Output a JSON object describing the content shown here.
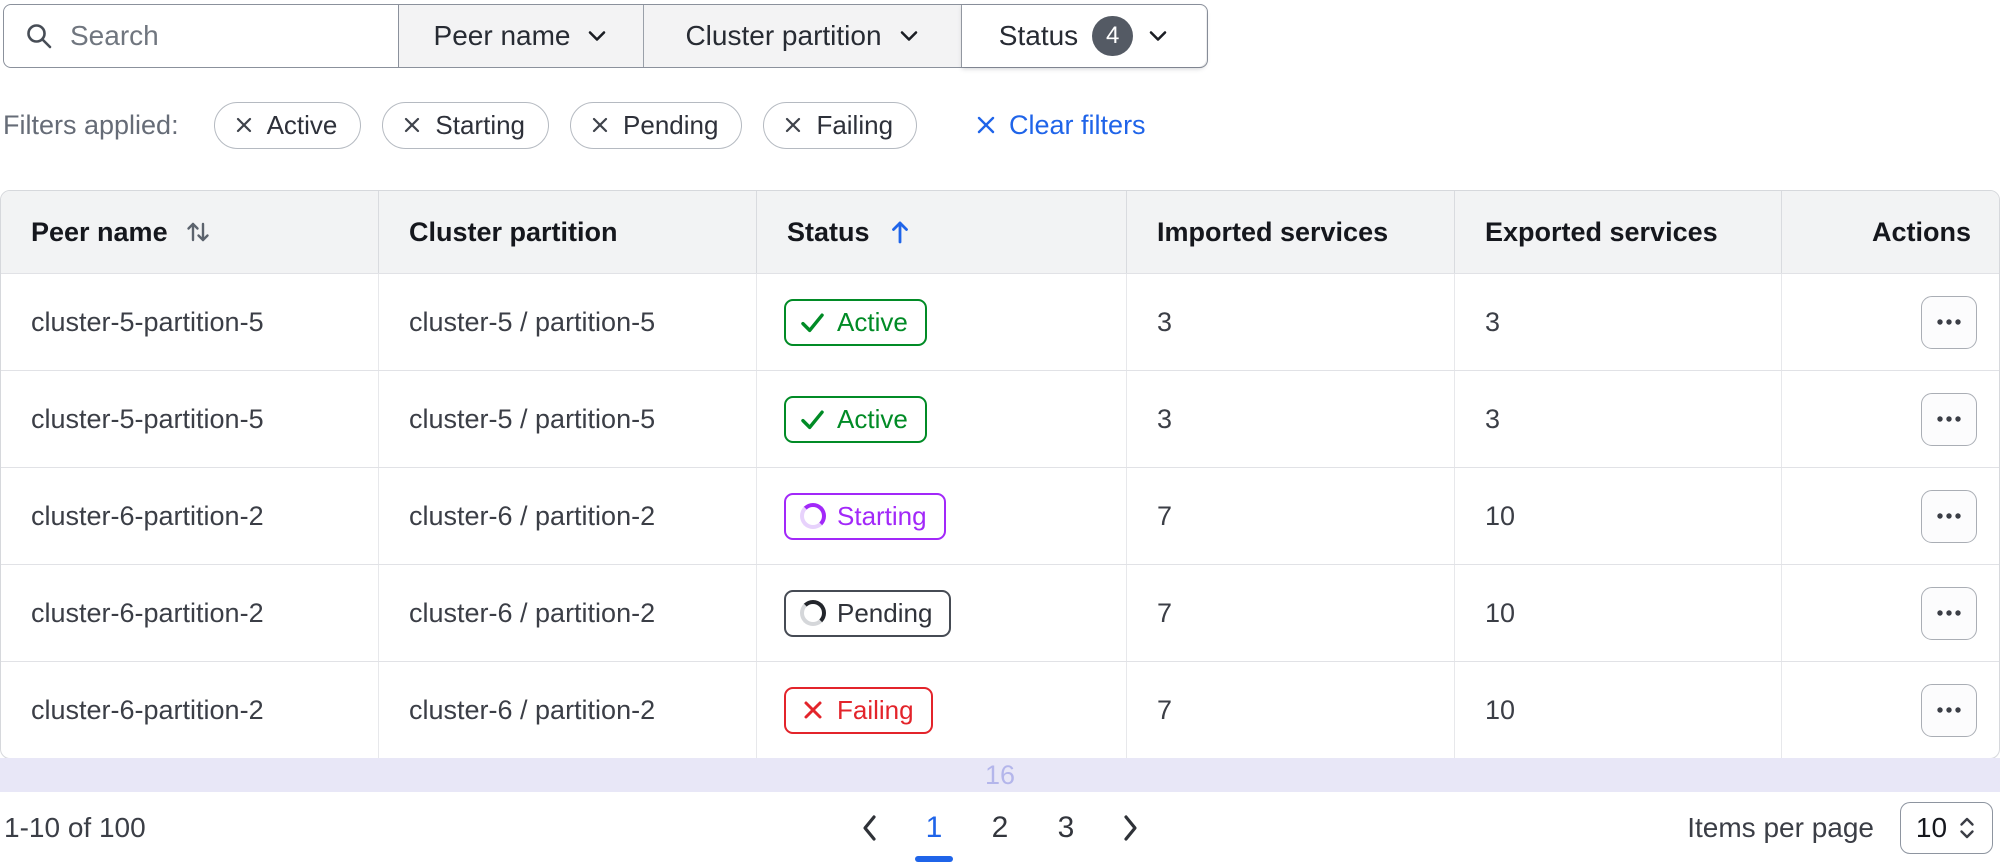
{
  "filters_bar": {
    "search_placeholder": "Search",
    "peer_dropdown": {
      "label": "Peer name"
    },
    "partition_dropdown": {
      "label": "Cluster partition"
    },
    "status_dropdown": {
      "label": "Status",
      "badge": "4"
    }
  },
  "applied": {
    "label": "Filters applied:",
    "pills": [
      "Active",
      "Starting",
      "Pending",
      "Failing"
    ],
    "clear_label": "Clear filters"
  },
  "table": {
    "columns": [
      "Peer name",
      "Cluster partition",
      "Status",
      "Imported services",
      "Exported services",
      "Actions"
    ],
    "sorted_column": "Status",
    "sort_direction": "ascending",
    "rows": [
      {
        "peer": "cluster-5-partition-5",
        "partition": "cluster-5 / partition-5",
        "status": "Active",
        "status_kind": "active",
        "imported": "3",
        "exported": "3"
      },
      {
        "peer": "cluster-5-partition-5",
        "partition": "cluster-5 / partition-5",
        "status": "Active",
        "status_kind": "active",
        "imported": "3",
        "exported": "3"
      },
      {
        "peer": "cluster-6-partition-2",
        "partition": "cluster-6 / partition-2",
        "status": "Starting",
        "status_kind": "starting",
        "imported": "7",
        "exported": "10"
      },
      {
        "peer": "cluster-6-partition-2",
        "partition": "cluster-6 / partition-2",
        "status": "Pending",
        "status_kind": "pending",
        "imported": "7",
        "exported": "10"
      },
      {
        "peer": "cluster-6-partition-2",
        "partition": "cluster-6 / partition-2",
        "status": "Failing",
        "status_kind": "failing",
        "imported": "7",
        "exported": "10"
      }
    ],
    "overflow_text": "16"
  },
  "pagination": {
    "range": "1-10 of 100",
    "pages": [
      "1",
      "2",
      "3"
    ],
    "active_page": "1",
    "items_per_page_label": "Items per page",
    "items_per_page_value": "10"
  },
  "colors": {
    "accent_blue": "#1f64e9",
    "success_green": "#018b26",
    "progress_purple": "#a228f9",
    "critical_red": "#e3242b",
    "pending_gray": "#464b54",
    "selected_row_bg": "#e8e7f7",
    "header_bg": "#f2f3f4",
    "status_count_badge_bg": "#545a64"
  }
}
